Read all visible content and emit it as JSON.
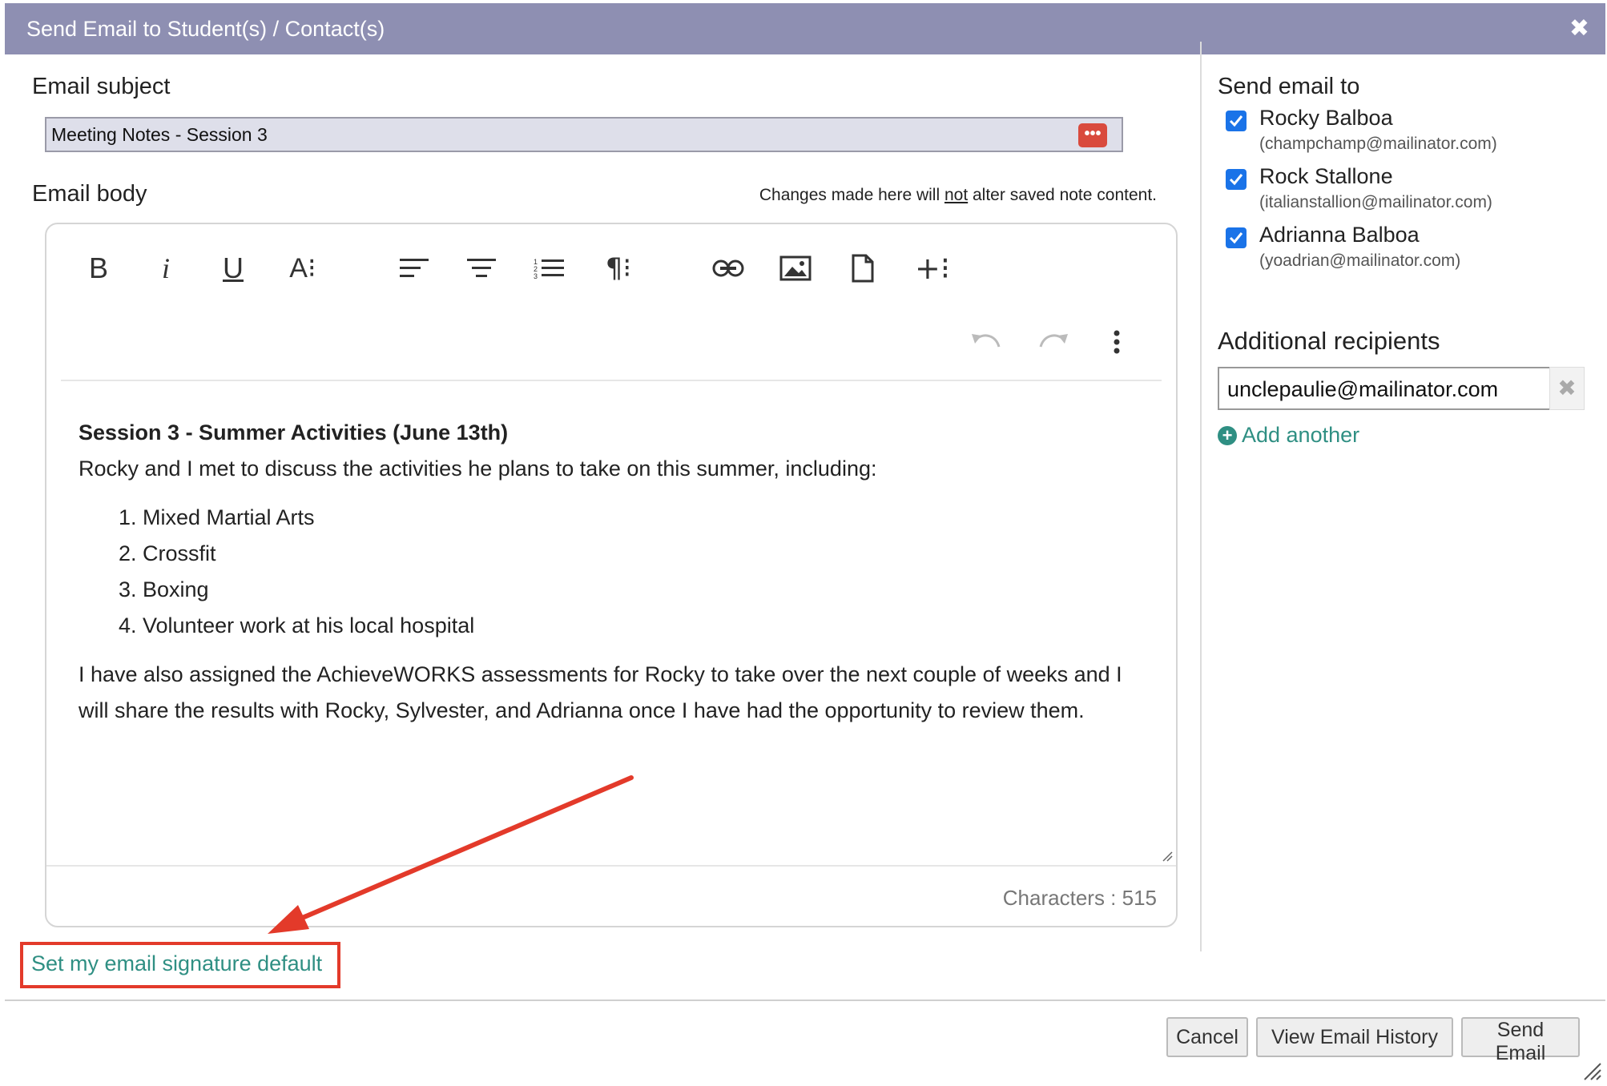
{
  "dialog": {
    "title": "Send Email to Student(s) / Contact(s)",
    "close_icon": "close-icon"
  },
  "subject": {
    "label": "Email subject",
    "value": "Meeting Notes - Session 3",
    "menu_icon": "dots-menu-icon"
  },
  "body": {
    "label": "Email body",
    "notice_prefix": "Changes made here will ",
    "notice_emph": "not",
    "notice_suffix": " alter saved note content.",
    "toolbar": [
      "bold-icon",
      "italic-icon",
      "underline-icon",
      "text-size-icon",
      "align-left-icon",
      "align-center-icon",
      "ordered-list-icon",
      "paragraph-icon",
      "link-icon",
      "image-icon",
      "file-icon",
      "insert-more-icon",
      "undo-icon",
      "redo-icon",
      "more-options-icon"
    ],
    "heading": "Session 3 - Summer Activities (June 13th)",
    "intro": "Rocky and I met to discuss the activities he plans to take on this summer, including:",
    "list": [
      "Mixed Martial Arts",
      "Crossfit",
      "Boxing",
      "Volunteer work at his local hospital"
    ],
    "closing": "I have also assigned the AchieveWORKS assessments for Rocky to take over the next couple of weeks and I will share the results with Rocky, Sylvester, and Adrianna once I have had the opportunity to review them.",
    "char_count": "Characters : 515"
  },
  "signature_link": "Set my email signature default",
  "annotation_color": "#e33a2a",
  "recipients": {
    "label": "Send email to",
    "list": [
      {
        "name": "Rocky Balboa",
        "email": "(champchamp@mailinator.com)",
        "checked": true
      },
      {
        "name": "Rock Stallone",
        "email": "(italianstallion@mailinator.com)",
        "checked": true
      },
      {
        "name": "Adrianna Balboa",
        "email": "(yoadrian@mailinator.com)",
        "checked": true
      }
    ]
  },
  "additional": {
    "label": "Additional recipients",
    "value": "unclepaulie@mailinator.com",
    "remove_icon": "remove-icon",
    "add_another": "Add another"
  },
  "buttons": {
    "cancel": "Cancel",
    "history": "View Email History",
    "send": "Send Email"
  },
  "colors": {
    "titlebar": "#8e8fb2",
    "link": "#2f8f83",
    "checkbox": "#1a73e8"
  }
}
